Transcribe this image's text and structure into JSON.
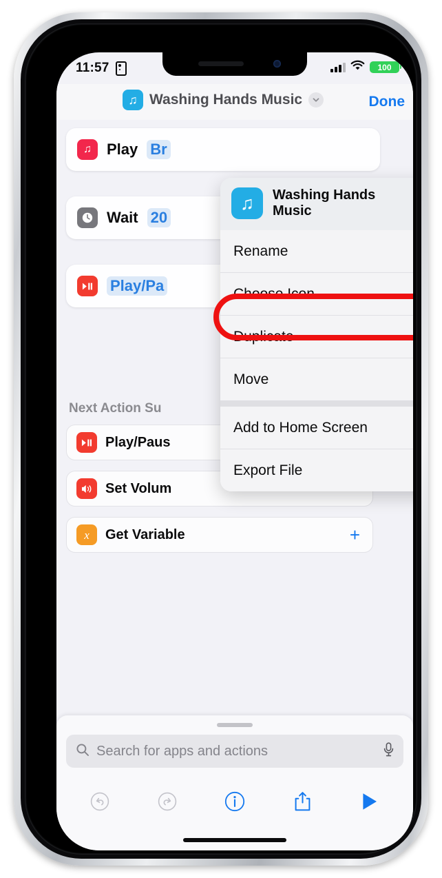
{
  "status_bar": {
    "time": "11:57",
    "lock_icon": "portrait-orientation-lock-icon",
    "signal_icon": "cellular-signal-icon",
    "wifi_icon": "wifi-icon",
    "battery_level": "100"
  },
  "titlebar": {
    "icon": "music-note-icon",
    "title": "Washing Hands Music",
    "chevron_icon": "chevron-down-icon",
    "done_label": "Done",
    "accent_color": "#1579ef",
    "icon_color": "#23ade5"
  },
  "workflow": {
    "actions": [
      {
        "icon": "music-note-icon",
        "icon_color": "#f2274c",
        "label": "Play",
        "param": "Br"
      },
      {
        "icon": "clock-icon",
        "icon_color": "#77777c",
        "label": "Wait",
        "param": "20"
      },
      {
        "icon": "play-pause-icon",
        "icon_color": "#f23b2f",
        "label": "",
        "param": "Play/Pa"
      }
    ],
    "section_heading": "Next Action Su",
    "suggestions": [
      {
        "icon": "play-pause-icon",
        "icon_color": "#f23b2f",
        "label": "Play/Paus"
      },
      {
        "icon": "speaker-wave-icon",
        "icon_color": "#f23b2f",
        "label": "Set Volum"
      },
      {
        "icon": "variable-x-icon",
        "icon_color": "#f59b25",
        "label": "Get Variable",
        "add_icon": "plus-icon"
      }
    ]
  },
  "context_menu": {
    "header": {
      "icon": "music-note-icon",
      "title": "Washing Hands Music",
      "share_icon": "share-icon"
    },
    "groups": [
      {
        "items": [
          {
            "label": "Rename",
            "icon": "pencil-icon"
          },
          {
            "label": "Choose Icon",
            "icon": "photo-icon",
            "highlighted": true
          },
          {
            "label": "Duplicate",
            "icon": "duplicate-icon"
          },
          {
            "label": "Move",
            "icon": "folder-icon"
          }
        ]
      },
      {
        "items": [
          {
            "label": "Add to Home Screen",
            "icon": "plus-square-icon"
          },
          {
            "label": "Export File",
            "icon": "export-icon"
          }
        ]
      }
    ],
    "highlight_color": "#ee1111"
  },
  "bottom_sheet": {
    "grabber": "sheet-grabber",
    "search": {
      "icon": "search-icon",
      "placeholder": "Search for apps and actions",
      "mic_icon": "microphone-icon"
    },
    "toolbar": [
      {
        "name": "undo-button",
        "icon": "undo-icon",
        "enabled": false
      },
      {
        "name": "redo-button",
        "icon": "redo-icon",
        "enabled": false
      },
      {
        "name": "info-button",
        "icon": "info-icon",
        "enabled": true
      },
      {
        "name": "share-button",
        "icon": "share-icon",
        "enabled": true
      },
      {
        "name": "play-button",
        "icon": "play-triangle-icon",
        "enabled": true
      }
    ]
  }
}
